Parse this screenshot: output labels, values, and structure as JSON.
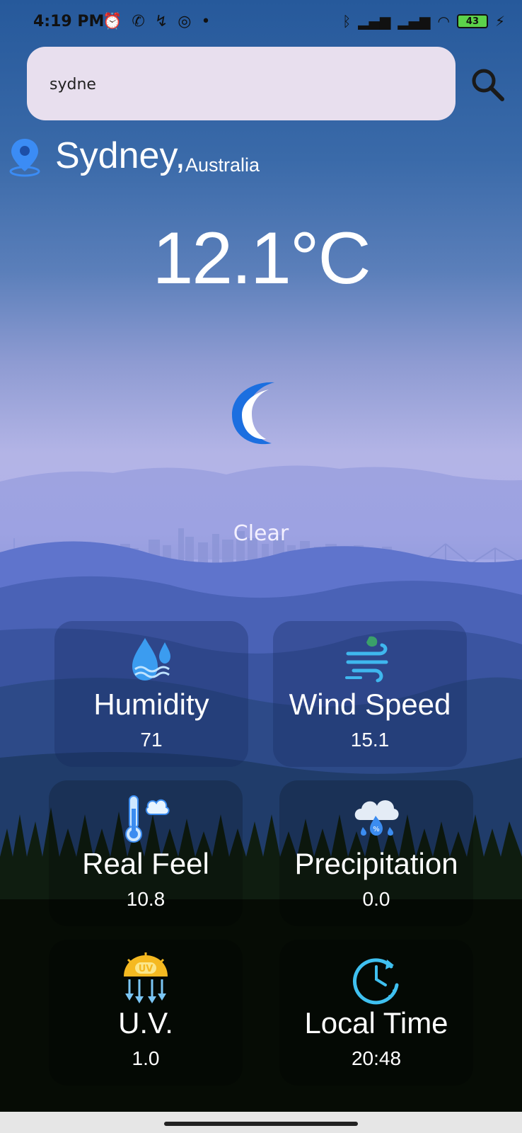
{
  "status_bar": {
    "time": "4:19 PM",
    "battery": "43"
  },
  "search": {
    "value": "sydne"
  },
  "location": {
    "city": "Sydney,",
    "country": "Australia"
  },
  "weather": {
    "temperature": "12.1°C",
    "condition": "Clear"
  },
  "cards": [
    {
      "title": "Humidity",
      "value": "71",
      "icon": "humidity-icon"
    },
    {
      "title": "Wind Speed",
      "value": "15.1",
      "icon": "wind-icon"
    },
    {
      "title": "Real Feel",
      "value": "10.8",
      "icon": "thermometer-icon"
    },
    {
      "title": "Precipitation",
      "value": "0.0",
      "icon": "precipitation-icon"
    },
    {
      "title": "U.V.",
      "value": "1.0",
      "icon": "uv-sun-icon"
    },
    {
      "title": "Local Time",
      "value": "20:48",
      "icon": "clock-icon"
    }
  ],
  "colors": {
    "search_bg": "#e8dfee",
    "location_pin": "#3b8cf5",
    "moon": "#1c6fe0"
  }
}
